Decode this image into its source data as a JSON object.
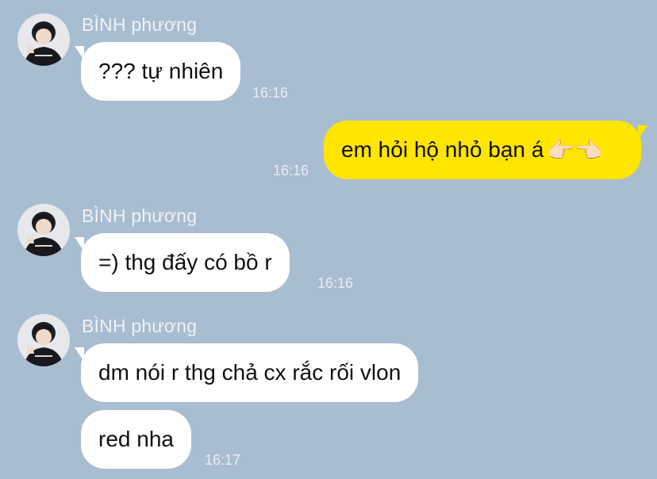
{
  "chat": {
    "background_color": "#a9bdd1",
    "incoming_bubble_color": "#ffffff",
    "outgoing_bubble_color": "#ffe500",
    "groups": [
      {
        "sender": "BÌNH phương",
        "messages": [
          {
            "text": "??? tự nhiên",
            "time": "16:16"
          }
        ]
      },
      {
        "outgoing": true,
        "messages": [
          {
            "text": "em hỏi hộ nhỏ bạn á",
            "emoji": "👉🏻👈🏻",
            "time": "16:16"
          }
        ]
      },
      {
        "sender": "BÌNH phương",
        "messages": [
          {
            "text": "=) thg đấy có bồ r",
            "time": "16:16"
          }
        ]
      },
      {
        "sender": "BÌNH phương",
        "messages": [
          {
            "text": "dm nói r thg chả cx rắc rối vlon"
          },
          {
            "text": "red nha",
            "time": "16:17"
          }
        ]
      }
    ]
  }
}
